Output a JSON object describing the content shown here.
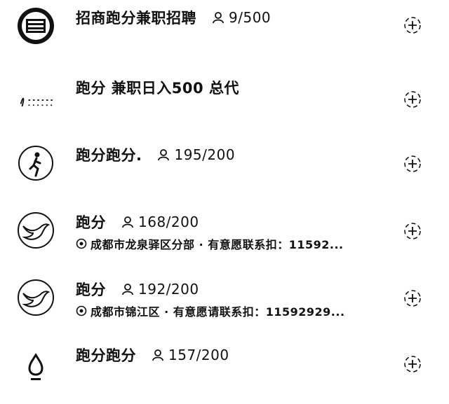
{
  "groups": [
    {
      "title": "招商跑分兼职招聘",
      "count": "9/500",
      "location": "",
      "avatar_icon": "badge-logo-icon"
    },
    {
      "title": "跑分 兼职日入500 总代",
      "count": "",
      "location": "",
      "avatar_icon": "signature-logo-icon"
    },
    {
      "title": "跑分跑分.",
      "count": "195/200",
      "location": "",
      "avatar_icon": "runner-icon"
    },
    {
      "title": "跑分",
      "count": "168/200",
      "location": "成都市龙泉驿区分部 · 有意愿联系扣：11592...",
      "avatar_icon": "bird-logo-icon"
    },
    {
      "title": "跑分",
      "count": "192/200",
      "location": "成都市锦江区 · 有意愿请联系扣：11592929...",
      "avatar_icon": "bird-logo-icon"
    },
    {
      "title": "跑分跑分",
      "count": "157/200",
      "location": "",
      "avatar_icon": "drop-icon"
    }
  ],
  "join_icon": "add-group-icon"
}
